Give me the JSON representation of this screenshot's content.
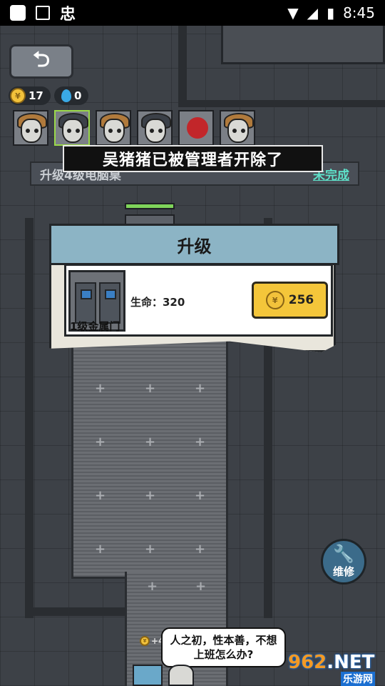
{
  "status_bar": {
    "time": "8:45",
    "bug_glyph": "忠"
  },
  "resources": {
    "coins": "17",
    "water": "0"
  },
  "portraits": [
    {
      "type": "girl"
    },
    {
      "type": "boy",
      "selected": true
    },
    {
      "type": "girl"
    },
    {
      "type": "boy"
    },
    {
      "type": "paw"
    },
    {
      "type": "girl"
    }
  ],
  "task": {
    "text": "升级4级电脑桌",
    "status": "未完成"
  },
  "toast": "吴猪猪已被管理者开除了",
  "dialog": {
    "title": "升级",
    "item_name": "1级金属门",
    "hp_label": "生命：320",
    "price": "256"
  },
  "repair_label": "维修",
  "speech": "人之初，性本善，不想上班怎么办?",
  "reward_text": "+4",
  "watermark": {
    "main_a": "962",
    "main_b": ".NET",
    "sub": "乐游网"
  },
  "colors": {
    "accent": "#f4c63a",
    "task_status": "#5ee0c8",
    "dialog_header": "#8cb4c5"
  }
}
